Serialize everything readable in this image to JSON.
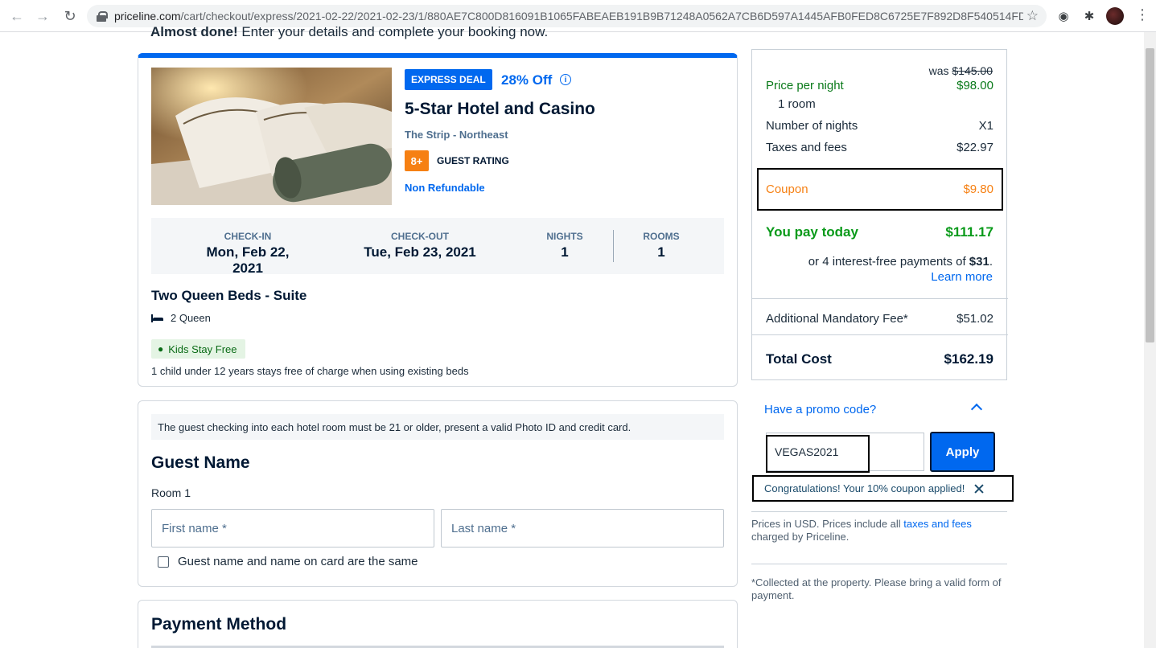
{
  "browser": {
    "url_host": "priceline.com",
    "url_path": "/cart/checkout/express/2021-02-22/2021-02-23/1/880AE7C800D816091B1065FABEAEB191B9B71248A0562A7CB6D597A1445AFB0FED8C6725E7F892D8F540514FD61..."
  },
  "page": {
    "header_bold": "Almost done!",
    "header_rest": " Enter your details and complete your booking now."
  },
  "hotel": {
    "badge": "EXPRESS DEAL",
    "discount": "28% Off",
    "name": "5-Star Hotel and Casino",
    "location": "The Strip - Northeast",
    "rating": "8+",
    "rating_label": "GUEST RATING",
    "refund": "Non Refundable",
    "checkin_label": "CHECK-IN",
    "checkin_value": "Mon, Feb 22, 2021",
    "checkout_label": "CHECK-OUT",
    "checkout_value": "Tue, Feb 23, 2021",
    "nights_label": "NIGHTS",
    "nights_value": "1",
    "rooms_label": "ROOMS",
    "rooms_value": "1",
    "room_name": "Two Queen Beds - Suite",
    "bed": "2 Queen",
    "kids_tag": "Kids Stay Free",
    "kids_note": "1 child under 12 years stays free of charge when using existing beds"
  },
  "guest": {
    "notice": "The guest checking into each hotel room must be 21 or older, present a valid Photo ID and credit card.",
    "title": "Guest Name",
    "room_label": "Room 1",
    "first_name_placeholder": "First name *",
    "last_name_placeholder": "Last name *",
    "same_name_label": "Guest name and name on card are the same"
  },
  "payment": {
    "title": "Payment Method"
  },
  "summary": {
    "was_label": "was",
    "was_price": "$145.00",
    "price_per_night_label": "Price per night",
    "price_per_night": "$98.00",
    "rooms_note": "1 room",
    "nights_label": "Number of nights",
    "nights_value": "X1",
    "taxes_label": "Taxes and fees",
    "taxes_value": "$22.97",
    "coupon_label": "Coupon",
    "coupon_value": "$9.80",
    "pay_today_label": "You pay today",
    "pay_today_value": "$111.17",
    "installments_prefix": "or 4 interest-free payments of ",
    "installments_amount": "$31",
    "installments_suffix": ".",
    "learn_more": "Learn more",
    "mandatory_fee_label": "Additional Mandatory Fee*",
    "mandatory_fee_value": "$51.02",
    "total_label": "Total Cost",
    "total_value": "$162.19"
  },
  "promo": {
    "question": "Have a promo code?",
    "code": "VEGAS2021",
    "apply_label": "Apply",
    "success": "Congratulations! Your 10% coupon applied!"
  },
  "footnotes": {
    "prices_prefix": "Prices in USD. Prices include all ",
    "prices_link": "taxes and fees",
    "prices_suffix": " charged by Priceline.",
    "collected": "*Collected at the property. Please bring a valid form of payment."
  },
  "colors": {
    "brand_blue": "#0068ef",
    "green": "#0a7a1a",
    "orange": "#f68013"
  }
}
